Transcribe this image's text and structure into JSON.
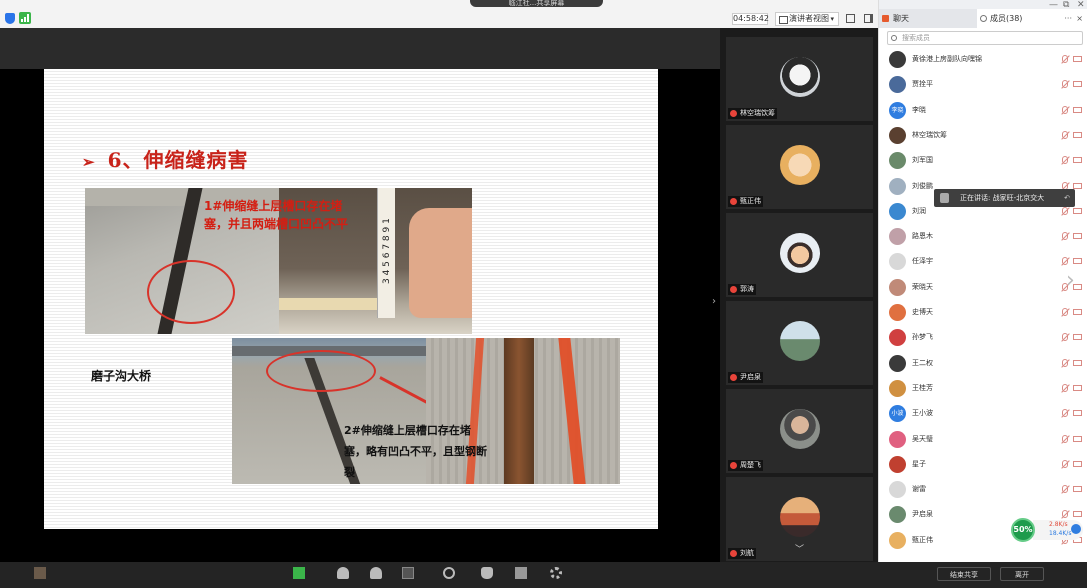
{
  "topbar": {
    "share_title": "临江社...共享屏幕",
    "timer": "04:58:42",
    "view_mode": "演讲者视图",
    "view_caret": "▾"
  },
  "slide": {
    "title_arrow": "➢",
    "title": "6、伸缩缝病害",
    "caption_1": "1#伸缩缝上层槽口存在堵塞，并且两端槽口凹凸不平",
    "caption_2": "2#伸缩缝上层槽口存在堵塞，略有凹凸不平，且型钢断裂",
    "bridge_label": "磨子沟大桥",
    "ruler_digits": "3 4 5 6 7 8 9 1"
  },
  "video_tiles": [
    {
      "name": "林空瑞饮筹",
      "avatar_color": "#3a5a8a"
    },
    {
      "name": "甄正伟",
      "avatar_color": "#e8b060"
    },
    {
      "name": "郭涛",
      "avatar_color": "#e9eef3"
    },
    {
      "name": "尹启泉",
      "avatar_color": "#6a8a6e"
    },
    {
      "name": "周楚飞",
      "avatar_color": "#8b8f8a"
    },
    {
      "name": "刘航",
      "avatar_color": "#c45a3a"
    }
  ],
  "panel": {
    "tab_chat": "聊天",
    "tab_members": "成员(38)",
    "more": "···",
    "close": "×",
    "search_placeholder": "搜索成员",
    "members": [
      {
        "name": "黄徐港上房副队向嘿锦",
        "color": "#3a3a3a"
      },
      {
        "name": "贾拴平",
        "color": "#4a6a9a"
      },
      {
        "name": "李晓",
        "color": "#2f7de0",
        "initials": "李晓"
      },
      {
        "name": "林空瑞饮筹",
        "color": "#5a4030"
      },
      {
        "name": "刘军国",
        "color": "#6a8a6a"
      },
      {
        "name": "刘俊鹏",
        "color": "#a0b0c0"
      },
      {
        "name": "刘润",
        "color": "#3a88d0"
      },
      {
        "name": "路恩木",
        "color": "#c0a0a8"
      },
      {
        "name": "任泽宇",
        "color": "#d8d8d8"
      },
      {
        "name": "荣晓天",
        "color": "#c08a78"
      },
      {
        "name": "史博天",
        "color": "#e07040"
      },
      {
        "name": "孙梦飞",
        "color": "#d04040"
      },
      {
        "name": "王二权",
        "color": "#3a3a3a"
      },
      {
        "name": "王桂芳",
        "color": "#d09040"
      },
      {
        "name": "王小波",
        "color": "#2f7de0",
        "initials": "小波"
      },
      {
        "name": "吴天璧",
        "color": "#e06080"
      },
      {
        "name": "星子",
        "color": "#c04030"
      },
      {
        "name": "谢雷",
        "color": "#d8d8d8"
      },
      {
        "name": "尹启泉",
        "color": "#6a8a6e"
      },
      {
        "name": "甄正伟",
        "color": "#e8b060"
      }
    ],
    "speaking": "正在讲话: 战家旺-北京交大",
    "speaking_back": "↶"
  },
  "network": {
    "percent": "50%",
    "up": "2.8K/s",
    "down": "18.4K/s"
  },
  "bottom": {
    "btn_share": "结束共享",
    "btn_leave": "离开"
  }
}
